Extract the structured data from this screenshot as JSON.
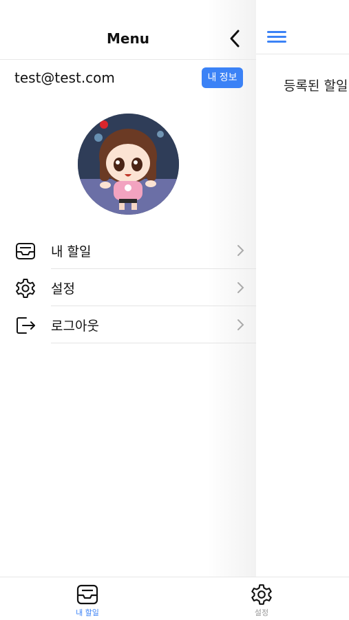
{
  "colors": {
    "accent": "#3b82f6",
    "inactive": "#999999"
  },
  "main": {
    "empty_text": "등록된 할일"
  },
  "drawer": {
    "title": "Menu",
    "email": "test@test.com",
    "info_button": "내 정보",
    "menu": [
      {
        "label": "내 할일",
        "icon": "inbox-tray-icon"
      },
      {
        "label": "설정",
        "icon": "gear-icon"
      },
      {
        "label": "로그아웃",
        "icon": "logout-icon"
      }
    ]
  },
  "tabs": [
    {
      "label": "내 할일",
      "icon": "inbox-tray-icon",
      "active": true
    },
    {
      "label": "설정",
      "icon": "gear-icon",
      "active": false
    }
  ]
}
